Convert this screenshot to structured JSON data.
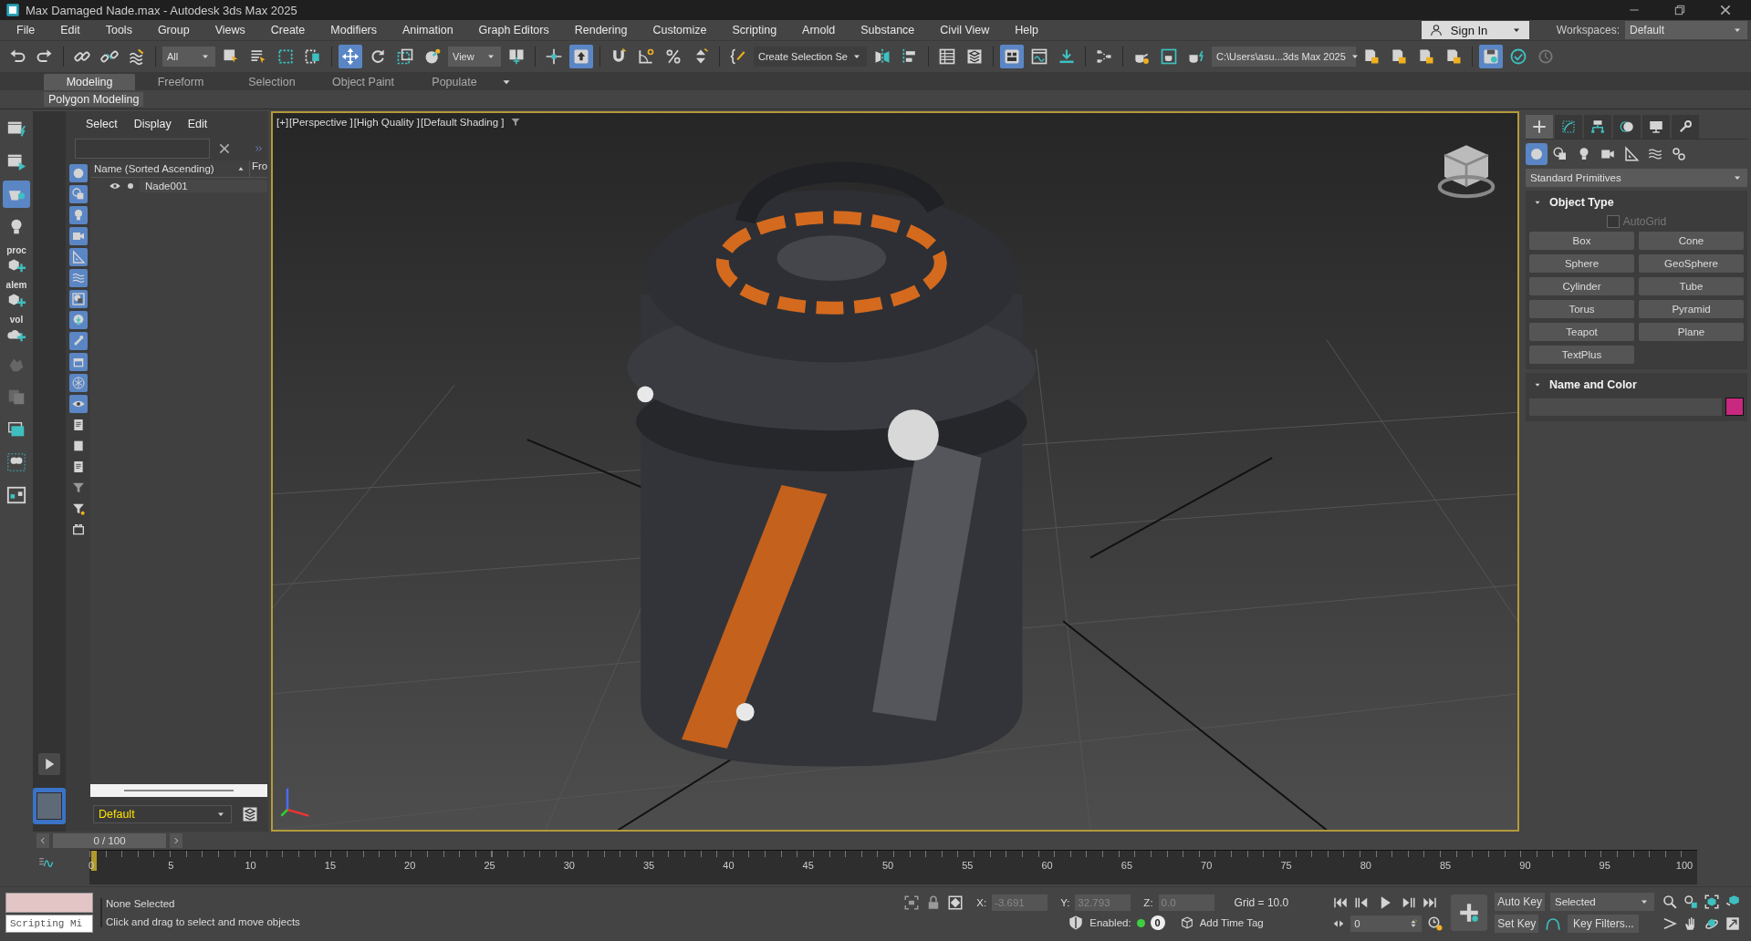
{
  "window": {
    "title": "Max Damaged Nade.max - Autodesk 3ds Max 2025"
  },
  "menu": [
    "File",
    "Edit",
    "Tools",
    "Group",
    "Views",
    "Create",
    "Modifiers",
    "Animation",
    "Graph Editors",
    "Rendering",
    "Customize",
    "Scripting",
    "Arnold",
    "Substance",
    "Civil View",
    "Help"
  ],
  "account": {
    "sign_in": "Sign In",
    "workspaces_label": "Workspaces:",
    "workspace": "Default"
  },
  "toolbar": [
    {
      "kind": "tool",
      "selected": false
    },
    {
      "kind": "tool",
      "selected": false
    },
    {
      "kind": "sep"
    },
    {
      "kind": "tool",
      "selected": false
    },
    {
      "kind": "tool",
      "selected": false
    },
    {
      "kind": "tool",
      "selected": false
    },
    {
      "kind": "sep"
    },
    {
      "kind": "dropdown",
      "value": "All"
    },
    {
      "kind": "tool",
      "selected": false
    },
    {
      "kind": "tool",
      "selected": false
    },
    {
      "kind": "tool",
      "selected": false
    },
    {
      "kind": "tool",
      "selected": false
    },
    {
      "kind": "sep"
    },
    {
      "kind": "tool",
      "selected": true
    },
    {
      "kind": "tool",
      "selected": false
    },
    {
      "kind": "tool",
      "selected": false
    },
    {
      "kind": "tool",
      "selected": false
    },
    {
      "kind": "dropdown",
      "value": "View"
    },
    {
      "kind": "tool",
      "selected": false
    },
    {
      "kind": "sep"
    },
    {
      "kind": "tool",
      "selected": false
    },
    {
      "kind": "tool",
      "selected": true
    },
    {
      "kind": "sep"
    },
    {
      "kind": "tool",
      "selected": false
    },
    {
      "kind": "tool",
      "selected": false
    },
    {
      "kind": "tool",
      "selected": false
    },
    {
      "kind": "tool",
      "selected": false
    },
    {
      "kind": "sep"
    },
    {
      "kind": "tool",
      "selected": false
    },
    {
      "kind": "dropdown",
      "value": "Create Selection Se"
    },
    {
      "kind": "tool",
      "selected": false
    },
    {
      "kind": "tool",
      "selected": false
    },
    {
      "kind": "sep"
    },
    {
      "kind": "tool",
      "selected": false
    },
    {
      "kind": "tool",
      "selected": false
    },
    {
      "kind": "sep"
    },
    {
      "kind": "tool",
      "selected": true
    },
    {
      "kind": "tool",
      "selected": false
    },
    {
      "kind": "tool",
      "selected": false
    },
    {
      "kind": "sep"
    },
    {
      "kind": "tool",
      "selected": false
    },
    {
      "kind": "sep"
    },
    {
      "kind": "tool",
      "selected": false
    },
    {
      "kind": "tool",
      "selected": false
    },
    {
      "kind": "tool",
      "selected": false
    },
    {
      "kind": "dropdown",
      "value": "C:\\Users\\asu...3ds Max 2025"
    },
    {
      "kind": "tool",
      "selected": false
    },
    {
      "kind": "tool",
      "selected": false
    },
    {
      "kind": "tool",
      "selected": false
    },
    {
      "kind": "tool",
      "selected": false
    },
    {
      "kind": "sep"
    },
    {
      "kind": "tool",
      "selected": true
    },
    {
      "kind": "tool",
      "selected": false
    },
    {
      "kind": "tool",
      "selected": false
    }
  ],
  "ribbon": {
    "tabs": [
      {
        "label": "Modeling",
        "selected": true
      },
      {
        "label": "Freeform",
        "selected": false
      },
      {
        "label": "Selection",
        "selected": false
      },
      {
        "label": "Object Paint",
        "selected": false
      },
      {
        "label": "Populate",
        "selected": false
      }
    ],
    "panel": "Polygon Modeling"
  },
  "left_tools": [
    {
      "selected": false
    },
    {
      "selected": false
    },
    {
      "selected": true
    },
    {
      "selected": false
    },
    {
      "selected": false,
      "label": "proc"
    },
    {
      "selected": false,
      "label": "alem"
    },
    {
      "selected": false,
      "label": "vol"
    },
    {
      "selected": false
    },
    {
      "selected": false
    },
    {
      "selected": false
    },
    {
      "selected": false
    },
    {
      "selected": false
    }
  ],
  "scene_explorer": {
    "menu": [
      "Select",
      "Display",
      "Edit"
    ],
    "filters": [
      {
        "selected": true
      },
      {
        "selected": true
      },
      {
        "selected": true
      },
      {
        "selected": true
      },
      {
        "selected": true
      },
      {
        "selected": true
      },
      {
        "selected": true
      },
      {
        "selected": true
      },
      {
        "selected": true
      },
      {
        "selected": true
      },
      {
        "selected": true
      },
      {
        "selected": true
      },
      {
        "selected": false
      },
      {
        "selected": false
      },
      {
        "selected": false
      }
    ],
    "columns": [
      "Name (Sorted Ascending)",
      "Fro"
    ],
    "rows": [
      {
        "name": "Nade001",
        "selected": false
      }
    ],
    "layer": "Default"
  },
  "viewport": {
    "labels": [
      "[+]",
      "[Perspective ]",
      "[High Quality ]",
      "[Default Shading ]"
    ],
    "active": true
  },
  "command_panel": {
    "tabs": [
      {
        "selected": true
      },
      {
        "selected": false
      },
      {
        "selected": false
      },
      {
        "selected": false
      },
      {
        "selected": false
      },
      {
        "selected": false
      }
    ],
    "categories": [
      {
        "selected": true
      },
      {
        "selected": false
      },
      {
        "selected": false
      },
      {
        "selected": false
      },
      {
        "selected": false
      },
      {
        "selected": false
      },
      {
        "selected": false
      }
    ],
    "dropdown": "Standard Primitives",
    "object_type": {
      "title": "Object Type",
      "expanded": true,
      "autogrid": {
        "label": "AutoGrid",
        "checked": false,
        "disabled": true
      },
      "buttons": [
        "Box",
        "Cone",
        "Sphere",
        "GeoSphere",
        "Cylinder",
        "Tube",
        "Torus",
        "Pyramid",
        "Teapot",
        "Plane",
        "TextPlus"
      ]
    },
    "name_and_color": {
      "title": "Name and Color",
      "expanded": true,
      "color": "#c8287f"
    }
  },
  "time_slider": {
    "position": "0 / 100",
    "level": 0
  },
  "track_bar": {
    "ticks": [
      "0",
      "5",
      "10",
      "15",
      "20",
      "25",
      "30",
      "35",
      "40",
      "45",
      "50",
      "55",
      "60",
      "65",
      "70",
      "75",
      "80",
      "85",
      "90",
      "95",
      "100"
    ]
  },
  "status": {
    "script_input": "Scripting Mi",
    "selection": "None Selected",
    "prompt": "Click and drag to select and move objects",
    "coords": [
      {
        "label": "X:",
        "value": "-3.691"
      },
      {
        "label": "Y:",
        "value": "32.793"
      },
      {
        "label": "Z:",
        "value": "0.0"
      }
    ],
    "grid": "Grid = 10.0",
    "enabled_label": "Enabled:",
    "enabled": true,
    "tag_count": "0",
    "add_time_tag": "Add Time Tag",
    "frame": "0",
    "auto_key": "Auto Key",
    "set_key": "Set Key",
    "key_mode": "Selected",
    "key_filters": "Key Filters..."
  }
}
